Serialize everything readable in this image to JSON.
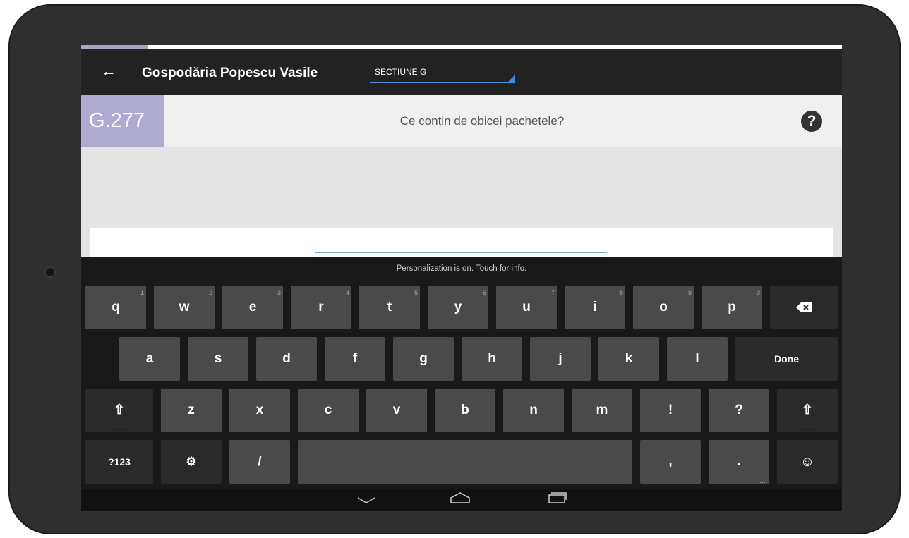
{
  "appbar": {
    "back_icon": "arrow-left-icon",
    "title": "Gospodăria Popescu Vasile",
    "section_select": "SECȚIUNE G"
  },
  "question": {
    "code": "G.277",
    "text": "Ce conțin de obicei pachetele?",
    "help_label": "?"
  },
  "answer": {
    "value": ""
  },
  "keyboard": {
    "hint": "Personalization is on. Touch for info.",
    "row1": [
      {
        "label": "q",
        "sub": "1"
      },
      {
        "label": "w",
        "sub": "2"
      },
      {
        "label": "e",
        "sub": "3"
      },
      {
        "label": "r",
        "sub": "4"
      },
      {
        "label": "t",
        "sub": "5"
      },
      {
        "label": "y",
        "sub": "6"
      },
      {
        "label": "u",
        "sub": "7"
      },
      {
        "label": "i",
        "sub": "8"
      },
      {
        "label": "o",
        "sub": "9"
      },
      {
        "label": "p",
        "sub": "0"
      }
    ],
    "backspace_icon": "backspace-icon",
    "row2": [
      "a",
      "s",
      "d",
      "f",
      "g",
      "h",
      "j",
      "k",
      "l"
    ],
    "done_label": "Done",
    "row3": [
      "z",
      "x",
      "c",
      "v",
      "b",
      "n",
      "m",
      "!",
      "?"
    ],
    "shift_icon": "shift-icon",
    "symbols_label": "?123",
    "settings_icon": "gear-icon",
    "slash_label": "/",
    "comma_label": ",",
    "period_label": ".",
    "emoji_icon": "smiley-icon"
  },
  "navbar": {
    "back_icon": "chevron-down-icon",
    "home_icon": "home-icon",
    "recents_icon": "recents-icon"
  }
}
